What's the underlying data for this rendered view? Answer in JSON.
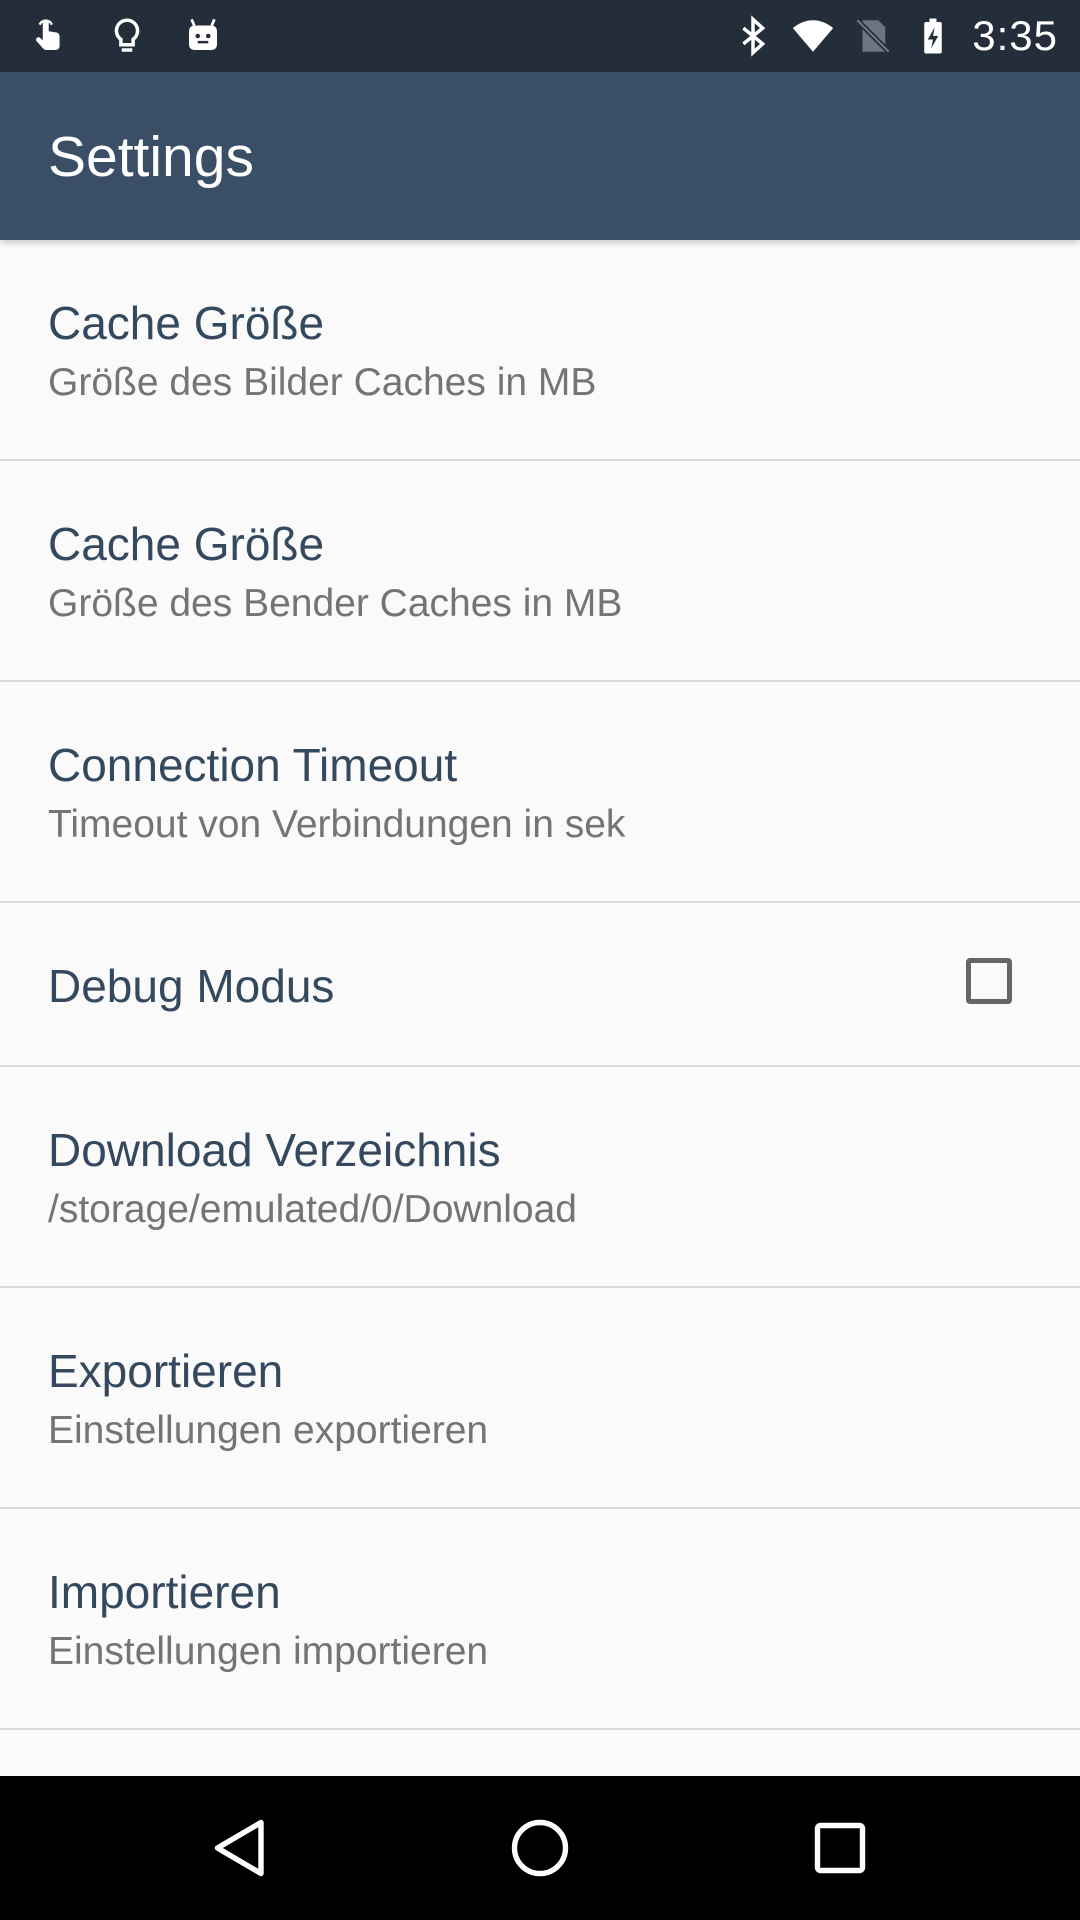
{
  "status_bar": {
    "left_icons": [
      "touch-hand-icon",
      "lightbulb-icon",
      "android-robot-icon"
    ],
    "right_icons": [
      "bluetooth-icon",
      "wifi-icon",
      "no-sim-icon",
      "battery-charging-icon"
    ],
    "time": "3:35"
  },
  "app_bar": {
    "title": "Settings",
    "color": "#3a4f65"
  },
  "preferences": [
    {
      "title": "Cache Größe",
      "summary": "Größe des Bilder Caches in MB"
    },
    {
      "title": "Cache Größe",
      "summary": "Größe des Bender Caches in MB"
    },
    {
      "title": "Connection Timeout",
      "summary": "Timeout von Verbindungen in sek"
    },
    {
      "title": "Debug Modus",
      "checked": false
    },
    {
      "title": "Download Verzeichnis",
      "summary": "/storage/emulated/0/Download"
    },
    {
      "title": "Exportieren",
      "summary": "Einstellungen exportieren"
    },
    {
      "title": "Importieren",
      "summary": "Einstellungen importieren"
    }
  ],
  "nav_bar": {
    "buttons": [
      "back-icon",
      "home-icon",
      "recents-icon"
    ]
  }
}
